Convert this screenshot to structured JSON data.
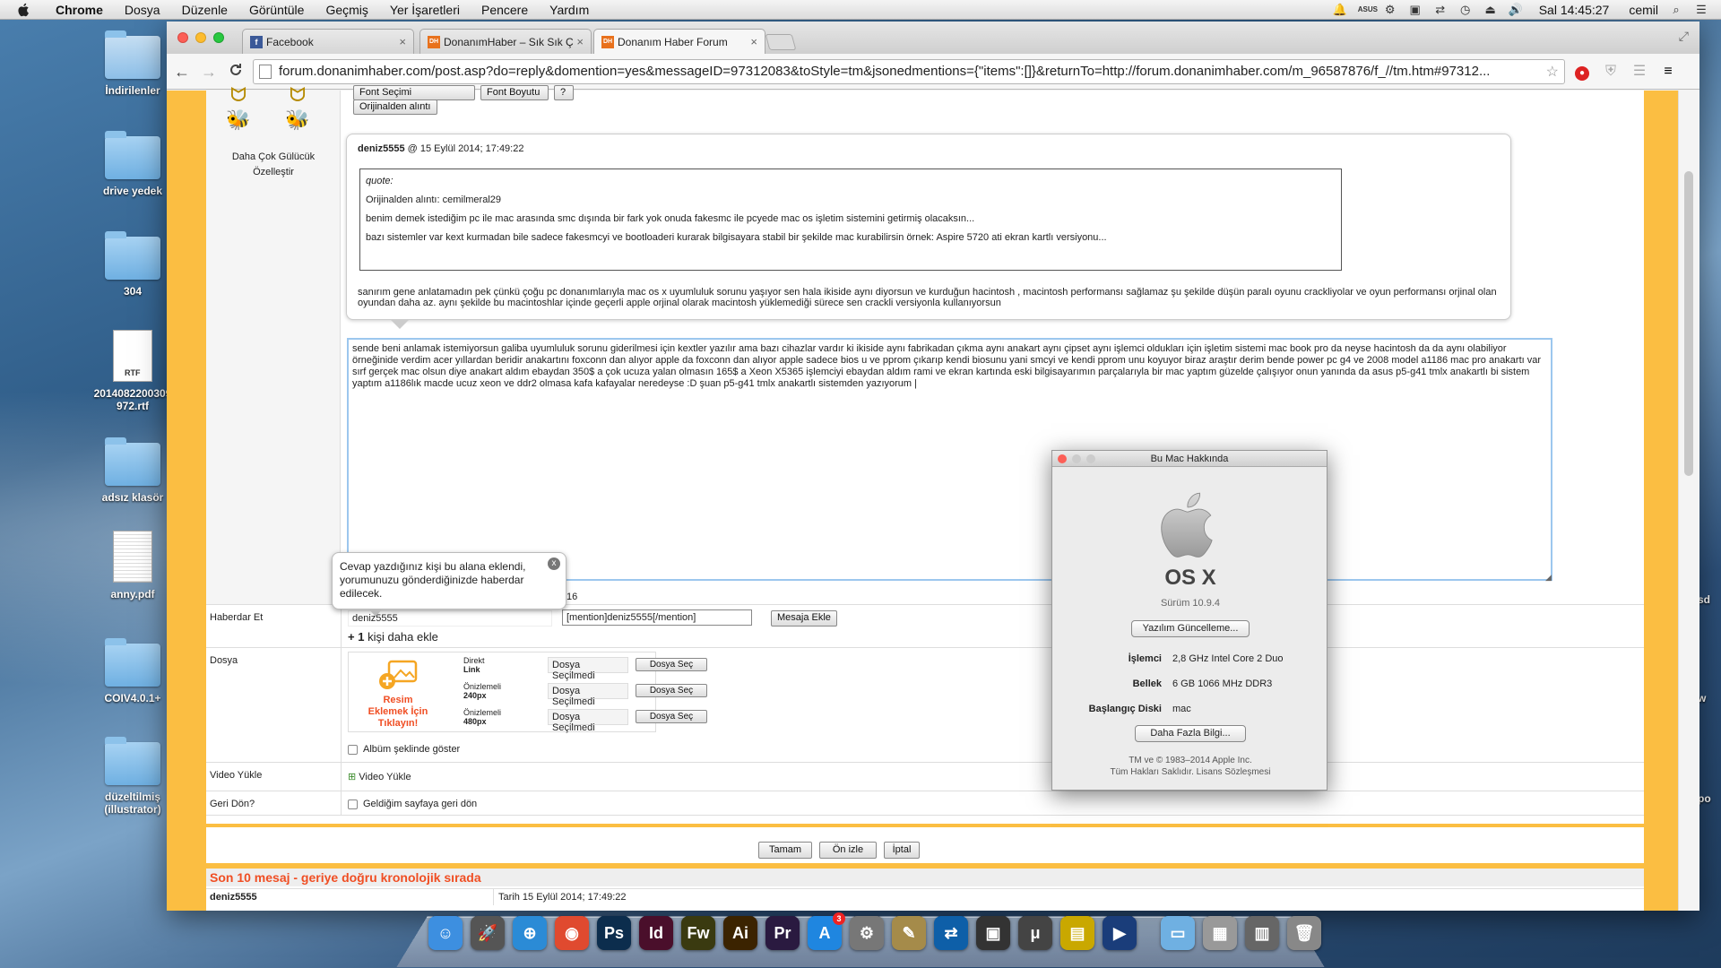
{
  "menubar": {
    "app": "Chrome",
    "items": [
      "Dosya",
      "Düzenle",
      "Görüntüle",
      "Geçmiş",
      "Yer İşaretleri",
      "Pencere",
      "Yardım"
    ],
    "clock": "Sal 14:45:27",
    "user": "cemil"
  },
  "desktop": {
    "icons": [
      {
        "label": "İndirilenler",
        "kind": "downloads"
      },
      {
        "label": "drive yedek",
        "kind": "folder"
      },
      {
        "label": "304",
        "kind": "folder"
      },
      {
        "label": "2014082200309972.rtf",
        "kind": "rtf"
      },
      {
        "label": "adsız klasör",
        "kind": "folder"
      },
      {
        "label": "anny.pdf",
        "kind": "pdf"
      },
      {
        "label": "COIV4.0.1+",
        "kind": "folder"
      },
      {
        "label": "düzeltilmiş (illustrator)",
        "kind": "folder"
      }
    ],
    "rtf_badge": "RTF",
    "edge_fragments": [
      "sd",
      "w",
      "po"
    ]
  },
  "browser": {
    "tabs": [
      {
        "title": "Facebook",
        "favicon": "f",
        "color": "#3b5998"
      },
      {
        "title": "DonanımHaber – Sık Sık Ç",
        "favicon": "DH",
        "color": "#e8711c"
      },
      {
        "title": "Donanım Haber Forum",
        "favicon": "DH",
        "color": "#e8711c"
      }
    ],
    "url": "forum.donanimhaber.com/post.asp?do=reply&domention=yes&messageID=97312083&toStyle=tm&jsonedmentions={\"items\":[]}&returnTo=http://forum.donanimhaber.com/m_96587876/f_//tm.htm#97312...",
    "nav": {
      "back": "←",
      "forward": "→",
      "reload": "C",
      "star": "☆",
      "menu": "≡"
    }
  },
  "forum": {
    "toolbar": {
      "font_select": "Font Seçimi",
      "font_size": "Font Boyutu",
      "help": "?",
      "quote_original": "Orijinalden alıntı"
    },
    "smileys": {
      "more": "Daha Çok Gülücük",
      "customize": "Özelleştir"
    },
    "quote": {
      "author": "deniz5555",
      "date": "@ 15 Eylül 2014; 17:49:22",
      "label": "quote:",
      "lines": [
        "Orijinalden alıntı: cemilmeral29",
        "benim demek istediğim pc ile mac arasında smc dışında bir fark yok onuda fakesmc ile pcyede mac os işletim sistemini getirmiş olacaksın...",
        "bazı sistemler var kext kurmadan bile sadece fakesmcyi ve bootloaderi kurarak bilgisayara stabil bir şekilde mac kurabilirsin örnek: Aspire 5720 ati ekran kartlı versiyonu..."
      ],
      "reply": "sanırım gene anlatamadın pek çünkü çoğu pc donanımlarıyla mac os x uyumluluk sorunu yaşıyor sen hala ikiside aynı diyorsun ve kurduğun hacintosh , macintosh performansı sağlamaz şu şekilde düşün paralı oyunu crackliyolar ve oyun performansı orjinal olan oyundan daha az. aynı şekilde bu macintoshlar içinde geçerli apple orjinal olarak macintosh yüklemediği sürece sen crackli versiyonla kullanıyorsun"
    },
    "editor_text": "sende beni anlamak istemiyorsun galiba uyumluluk sorunu giderilmesi için kextler yazılır ama bazı cihazlar vardır ki ikiside aynı fabrikadan çıkma aynı anakart aynı çipset aynı işlemci oldukları için işletim sistemi mac book pro da neyse hacintosh da da aynı olabiliyor örneğinide verdim acer yıllardan beridir anakartını foxconn dan alıyor apple da foxconn dan alıyor apple sadece bios u ve pprom çıkarıp kendi biosunu yani smcyi ve kendi pprom unu koyuyor biraz araştır derim bende power pc g4 ve 2008 model a1186 mac pro anakartı var sırf gerçek mac olsun diye anakart aldım ebaydan 350$ a çok ucuza yalan olmasın 165$ a Xeon X5365 işlemciyi ebaydan aldım rami ve ekran kartında eski bilgisayarımın parçalarıyla bir mac yaptım güzelde çalışıyor onun yanında da asus p5-g41 tmlx anakartlı bi sistem yaptım a1186lık macde ucuz xeon ve ddr2 olmasa kafa kafayalar neredeyse :D şuan p5-g41 tmlx anakartlı sistemden yazıyorum |",
    "char_count": "16",
    "tooltip": {
      "text": "Cevap yazdığınız kişi bu alana eklendi, yorumunuzu gönderdiğinizde haberdar edilecek.",
      "close": "x"
    },
    "notify": {
      "label": "Haberdar Et",
      "user": "deniz5555",
      "mention": "[mention]deniz5555[/mention]",
      "add_button": "Mesaja Ekle",
      "plus_count": "1",
      "more": "kişi daha ekle"
    },
    "file": {
      "label": "Dosya",
      "upload_title": "Resim Eklemek İçin Tıklayın!",
      "rows": [
        {
          "label": "Direkt",
          "sub": "Link",
          "value": "Dosya Seçilmedi",
          "button": "Dosya Seç"
        },
        {
          "label": "Önizlemeli",
          "sub": "240px",
          "value": "Dosya Seçilmedi",
          "button": "Dosya Seç"
        },
        {
          "label": "Önizlemeli",
          "sub": "480px",
          "value": "Dosya Seçilmedi",
          "button": "Dosya Seç"
        }
      ],
      "album": "Albüm şeklinde göster"
    },
    "video": {
      "label": "Video Yükle",
      "link": "Video Yükle"
    },
    "back": {
      "label": "Geri Dön?",
      "option": "Geldiğim sayfaya geri dön"
    },
    "buttons": {
      "ok": "Tamam",
      "preview": "Ön izle",
      "cancel": "İptal"
    },
    "recent": {
      "title": "Son 10 mesaj - geriye doğru kronolojik sırada",
      "author": "deniz5555",
      "date": "Tarih 15 Eylül 2014; 17:49:22"
    }
  },
  "about_mac": {
    "title": "Bu Mac Hakkında",
    "os": "OS X",
    "version": "Sürüm 10.9.4",
    "update_button": "Yazılım Güncelleme...",
    "specs": [
      {
        "key": "İşlemci",
        "value": "2,8 GHz Intel Core 2 Duo"
      },
      {
        "key": "Bellek",
        "value": "6 GB 1066 MHz DDR3"
      },
      {
        "key": "Başlangıç Diski",
        "value": "mac"
      }
    ],
    "more_button": "Daha Fazla Bilgi...",
    "footer1": "TM ve © 1983–2014 Apple Inc.",
    "footer2": "Tüm Hakları Saklıdır.  Lisans Sözleşmesi"
  },
  "dock": {
    "apps": [
      {
        "name": "finder-icon",
        "glyph": "☺",
        "color": "#3d8fe0"
      },
      {
        "name": "launchpad-icon",
        "glyph": "🚀",
        "color": "#555"
      },
      {
        "name": "safari-icon",
        "glyph": "⊕",
        "color": "#2b8bd6"
      },
      {
        "name": "chrome-icon",
        "glyph": "◉",
        "color": "#e04a2f"
      },
      {
        "name": "photoshop-icon",
        "glyph": "Ps",
        "color": "#0c2d4d"
      },
      {
        "name": "indesign-icon",
        "glyph": "Id",
        "color": "#4a0f2b"
      },
      {
        "name": "fireworks-icon",
        "glyph": "Fw",
        "color": "#3a3a10"
      },
      {
        "name": "illustrator-icon",
        "glyph": "Ai",
        "color": "#3b2300"
      },
      {
        "name": "premiere-icon",
        "glyph": "Pr",
        "color": "#2a1a40"
      },
      {
        "name": "appstore-icon",
        "glyph": "A",
        "color": "#1f86e0"
      },
      {
        "name": "system-preferences-icon",
        "glyph": "⚙",
        "color": "#777"
      },
      {
        "name": "app-icon",
        "glyph": "✎",
        "color": "#a58b4a"
      },
      {
        "name": "teamviewer-icon",
        "glyph": "⇄",
        "color": "#0e5fa8"
      },
      {
        "name": "video-icon",
        "glyph": "▣",
        "color": "#333"
      },
      {
        "name": "utorrent-icon",
        "glyph": "μ",
        "color": "#444"
      },
      {
        "name": "archive-icon",
        "glyph": "▤",
        "color": "#c9a800"
      },
      {
        "name": "quicktime-icon",
        "glyph": "▶",
        "color": "#1a3d7a"
      },
      {
        "name": "folder-icon",
        "glyph": "▭",
        "color": "#6fb0e2"
      },
      {
        "name": "downloads-stack-icon",
        "glyph": "▦",
        "color": "#999"
      },
      {
        "name": "document-stack-icon",
        "glyph": "▥",
        "color": "#666"
      },
      {
        "name": "trash-icon",
        "glyph": "🗑",
        "color": "#888"
      }
    ],
    "appstore_badge": "3"
  }
}
